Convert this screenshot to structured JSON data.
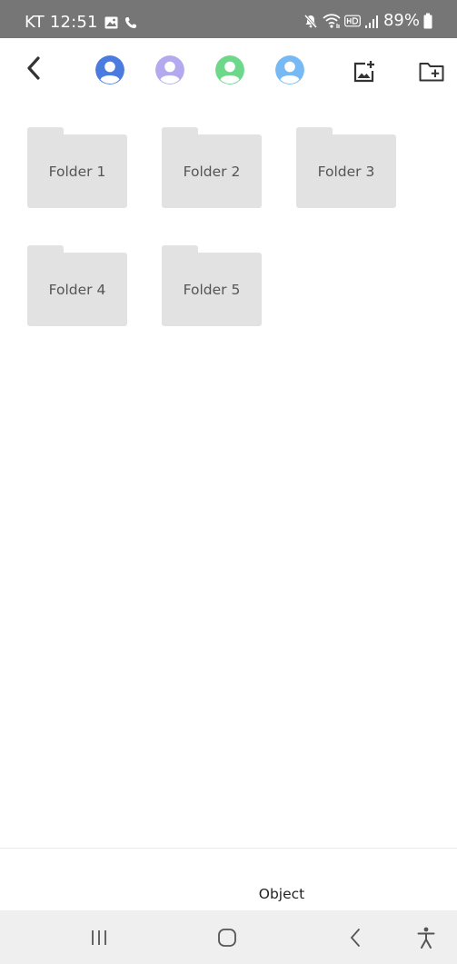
{
  "status_bar": {
    "carrier": "KT",
    "time": "12:51",
    "battery_percent": "89%",
    "icons": [
      "gallery-icon",
      "phone-icon",
      "mute-icon",
      "wifi-icon",
      "hd-icon",
      "signal-icon",
      "battery-icon"
    ],
    "text_color": "#ffffff",
    "background": "#767676"
  },
  "toolbar": {
    "icons": [
      "back-arrow-icon",
      "add-image-icon",
      "add-folder-icon"
    ],
    "avatars": [
      {
        "name": "avatar-blue",
        "color": "#4c7be0"
      },
      {
        "name": "avatar-lavender",
        "color": "#b3a9ee"
      },
      {
        "name": "avatar-green",
        "color": "#6ed88a"
      },
      {
        "name": "avatar-light-blue",
        "color": "#76b9f4"
      }
    ]
  },
  "folders": [
    {
      "label": "Folder 1"
    },
    {
      "label": "Folder 2"
    },
    {
      "label": "Folder 3"
    },
    {
      "label": "Folder 4"
    },
    {
      "label": "Folder 5"
    }
  ],
  "footer": {
    "object_label": "Object"
  },
  "nav_bar": {
    "icons": [
      "recent-apps-icon",
      "home-icon",
      "back-icon",
      "accessibility-icon"
    ]
  }
}
